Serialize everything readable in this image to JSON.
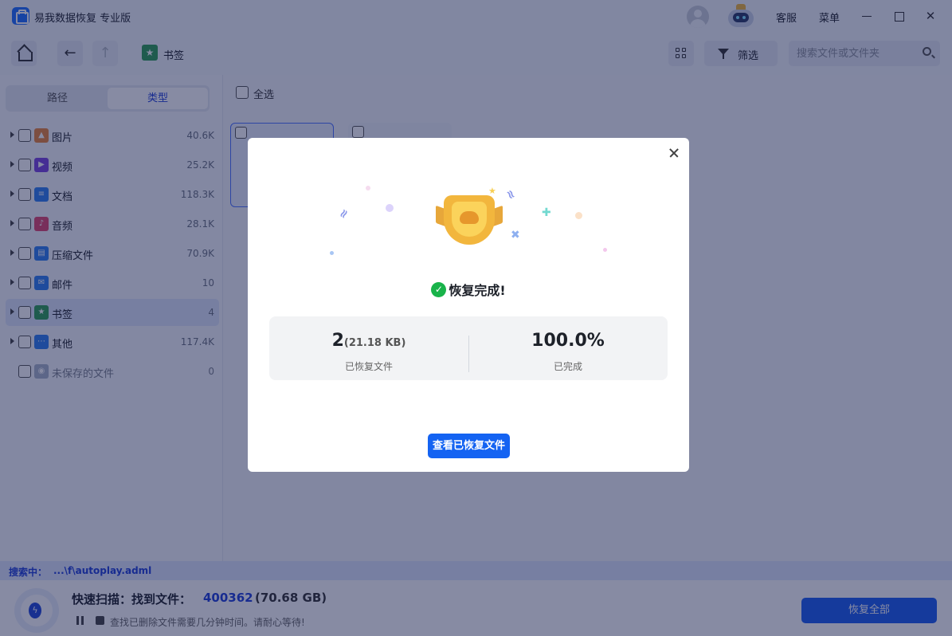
{
  "app": {
    "title": "易我数据恢复 专业版",
    "support_label": "客服",
    "menu_label": "菜单"
  },
  "toolbar": {
    "breadcrumb": "书签",
    "filter_label": "筛选",
    "search_placeholder": "搜索文件或文件夹"
  },
  "sidebar": {
    "tabs": {
      "path": "路径",
      "type": "类型"
    },
    "categories": [
      {
        "label": "图片",
        "count": "40.6K",
        "icon": "image-icon",
        "color": "#e9853a"
      },
      {
        "label": "视频",
        "count": "25.2K",
        "icon": "video-icon",
        "color": "#7b45e0"
      },
      {
        "label": "文档",
        "count": "118.3K",
        "icon": "document-icon",
        "color": "#2f7ff0"
      },
      {
        "label": "音频",
        "count": "28.1K",
        "icon": "audio-icon",
        "color": "#e0466e"
      },
      {
        "label": "压缩文件",
        "count": "70.9K",
        "icon": "archive-icon",
        "color": "#2f7ff0"
      },
      {
        "label": "邮件",
        "count": "10",
        "icon": "mail-icon",
        "color": "#2f7ff0"
      },
      {
        "label": "书签",
        "count": "4",
        "icon": "bookmark-icon",
        "color": "#2f9e55"
      },
      {
        "label": "其他",
        "count": "117.4K",
        "icon": "other-icon",
        "color": "#2f7ff0"
      },
      {
        "label": "未保存的文件",
        "count": "0",
        "icon": "unsaved-file-icon",
        "color": "#a9b4c8"
      }
    ]
  },
  "main": {
    "select_all": "全选"
  },
  "status": {
    "searching_label": "搜索中：",
    "searching_path": "...\\f\\autoplay.adml",
    "scan_title": "快速扫描：找到文件：",
    "scan_count": "400362",
    "scan_size": "(70.68 GB)",
    "scan_hint": "查找已删除文件需要几分钟时间。请耐心等待!",
    "recover_all": "恢复全部"
  },
  "modal": {
    "title": "恢复完成!",
    "recovered_count": "2",
    "recovered_size": "(21.18 KB)",
    "recovered_label": "已恢复文件",
    "progress": "100.0%",
    "progress_label": "已完成",
    "view_button": "查看已恢复文件"
  },
  "colors": {
    "accent": "#1463f2",
    "overlay": "#101848",
    "success": "#19b34a"
  }
}
